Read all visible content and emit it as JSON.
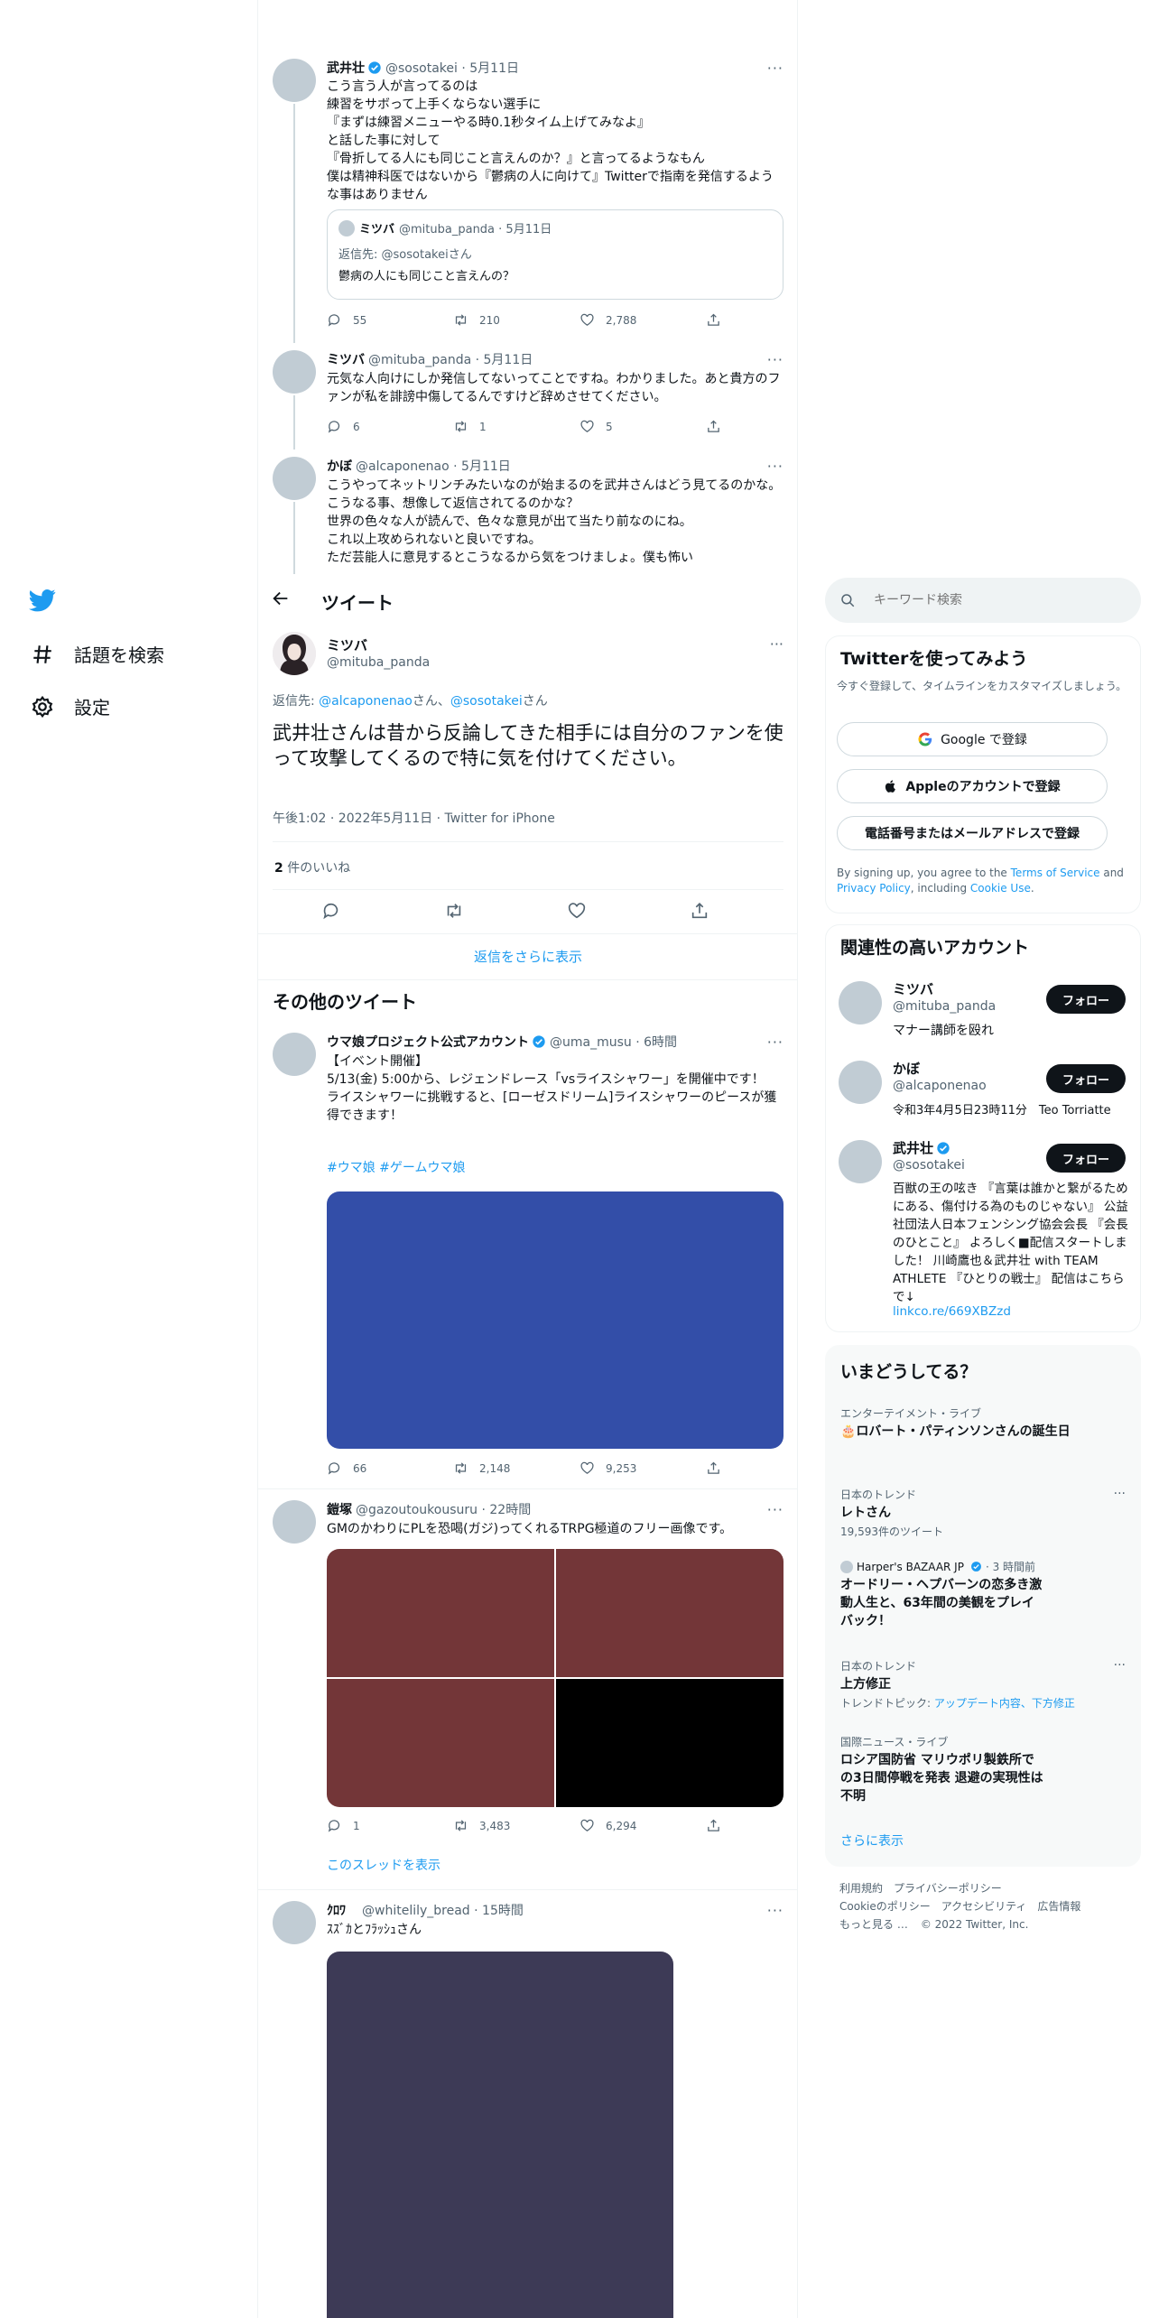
{
  "nav": {
    "explore_label": "話題を検索",
    "settings_label": "設定"
  },
  "header": {
    "title": "ツイート"
  },
  "thread": [
    {
      "name": "武井壮",
      "handle": "@sosotakei · 5月11日",
      "text": "こう言う人が言ってるのは\n練習をサボって上手くならない選手に\n『まずは練習メニューやる時0.1秒タイム上げてみなよ』\nと話した事に対して\n『骨折してる人にも同じこと言えんのか？』と言ってるようなもん\n僕は精神科医ではないから『鬱病の人に向けて』Twitterで指南を発信するような事はありません",
      "quote": {
        "name": "ミツバ",
        "handle": "@mituba_panda · 5月11日",
        "reply_to": "返信先: @sosotakeiさん",
        "text": "鬱病の人にも同じこと言えんの？"
      },
      "replies": "55",
      "retweets": "210",
      "likes": "2,788"
    },
    {
      "name": "ミツバ",
      "handle": "@mituba_panda · 5月11日",
      "text": "元気な人向けにしか発信してないってことですね。わかりました。あと貴方のファンが私を誹謗中傷してるんですけど辞めさせてください。",
      "replies": "6",
      "retweets": "1",
      "likes": "5"
    },
    {
      "name": "かぼ",
      "handle": "@alcaponenao · 5月11日",
      "text": "こうやってネットリンチみたいなのが始まるのを武井さんはどう見てるのかな。\nこうなる事、想像して返信されてるのかな？\n世界の色々な人が読んで、色々な意見が出て当たり前なのにね。\nこれ以上攻められないと良いですね。\nただ芸能人に意見するとこうなるから気をつけましょ。僕も怖い"
    }
  ],
  "main_tweet": {
    "name": "ミツバ",
    "handle": "@mituba_panda",
    "reply_prefix": "返信先: ",
    "reply_user1": "@alcaponenao",
    "reply_mid": "さん、",
    "reply_user2": "@sosotakei",
    "reply_suffix": "さん",
    "text": "武井壮さんは昔から反論してきた相手には自分のファンを使って攻撃してくるので特に気を付けてください。",
    "meta": "午後1:02 · 2022年5月11日 · Twitter for iPhone",
    "likes_count": "2",
    "likes_label": " 件のいいね",
    "more_replies": "返信をさらに表示"
  },
  "other_tweets_heading": "その他のツイート",
  "other_tweets": [
    {
      "name": "ウマ娘プロジェクト公式アカウント",
      "handle": "@uma_musu · 6時間",
      "text": "【イベント開催】\n5/13(金) 5:00から、レジェンドレース「vsライスシャワー」を開催中です！\nライスシャワーに挑戦すると、[ローゼスドリーム]ライスシャワーのピースが獲得できます！",
      "hashtags": "#ウマ娘 #ゲームウマ娘",
      "media_color": "#334ea8",
      "replies": "66",
      "retweets": "2,148",
      "likes": "9,253"
    },
    {
      "name": "鎧塚",
      "handle": "@gazoutoukousuru · 22時間",
      "text": "GMのかわりにPLを恐喝(ガジ)ってくれるTRPG極道のフリー画像です。",
      "media_colors": [
        "#733638",
        "#733638",
        "#733638",
        "#000000"
      ],
      "replies": "1",
      "retweets": "3,483",
      "likes": "6,294",
      "show_thread": "このスレッドを表示"
    },
    {
      "name": "ｸﾛﾜ",
      "handle": "@whitelily_bread · 15時間",
      "text": "ｽｽﾞｶとﾌﾗｯｼｭさん",
      "media_color": "#3d3a56"
    }
  ],
  "search": {
    "placeholder": "キーワード検索"
  },
  "signup": {
    "title": "Twitterを使ってみよう",
    "subtitle": "今すぐ登録して、タイムラインをカスタマイズしましょう。",
    "google": "Google で登録",
    "apple": "Appleのアカウントで登録",
    "phone": "電話番号またはメールアドレスで登録",
    "legal_pre": "By signing up, you agree to the ",
    "terms": "Terms of Service",
    "legal_and": " and ",
    "privacy": "Privacy Policy",
    "legal_mid": ", including ",
    "cookie": "Cookie Use",
    "legal_end": "."
  },
  "relevant": {
    "title": "関連性の高いアカウント",
    "follow_label": "フォロー",
    "accounts": [
      {
        "name": "ミツバ",
        "handle": "@mituba_panda",
        "bio": "マナー講師を殴れ"
      },
      {
        "name": "かぼ",
        "handle": "@alcaponenao",
        "bio": "令和3年4月5日23時11分　Teo Torriatte"
      },
      {
        "name": "武井壮",
        "handle": "@sosotakei",
        "bio": "百獣の王の呟き 『言葉は誰かと繋がるためにある、傷付ける為のものじゃない』 公益社団法人日本フェンシング協会会長 『会長のひとこと』 よろしく■配信スタートしました！ 川崎鷹也＆武井壮 with TEAM ATHLETE 『ひとりの戦士』 配信はこちらで↓",
        "link": "linkco.re/669XBZzd"
      }
    ]
  },
  "trends": {
    "title": "いまどうしてる？",
    "items": [
      {
        "cat": "エンターテイメント・ライブ",
        "title": "🎂ロバート・パティンソンさんの誕生日"
      },
      {
        "cat": "日本のトレンド",
        "title": "レトさん",
        "sub": "19,593件のツイート"
      },
      {
        "source": "Harper's BAZAAR JP",
        "time": " · 3 時間前",
        "title": "オードリー・ヘプバーンの恋多き激動人生と、63年間の美観をプレイバック！"
      },
      {
        "cat": "日本のトレンド",
        "title": "上方修正",
        "sub_pre": "トレンドトピック: ",
        "sub_link": "アップデート内容、下方修正"
      },
      {
        "cat": "国際ニュース・ライブ",
        "title": "ロシア国防省 マリウポリ製鉄所での3日間停戦を発表 退避の実現性は不明"
      }
    ],
    "show_more": "さらに表示"
  },
  "footer": {
    "terms": "利用規約",
    "privacy": "プライバシーポリシー",
    "cookie": "Cookieのポリシー",
    "accessibility": "アクセシビリティ",
    "ads": "広告情報",
    "more": "もっと見る …",
    "copyright": "© 2022 Twitter, Inc."
  },
  "colors": {
    "accent": "#1d9bf0",
    "text": "#0f1419",
    "muted": "#536471",
    "border": "#eff3f4"
  }
}
